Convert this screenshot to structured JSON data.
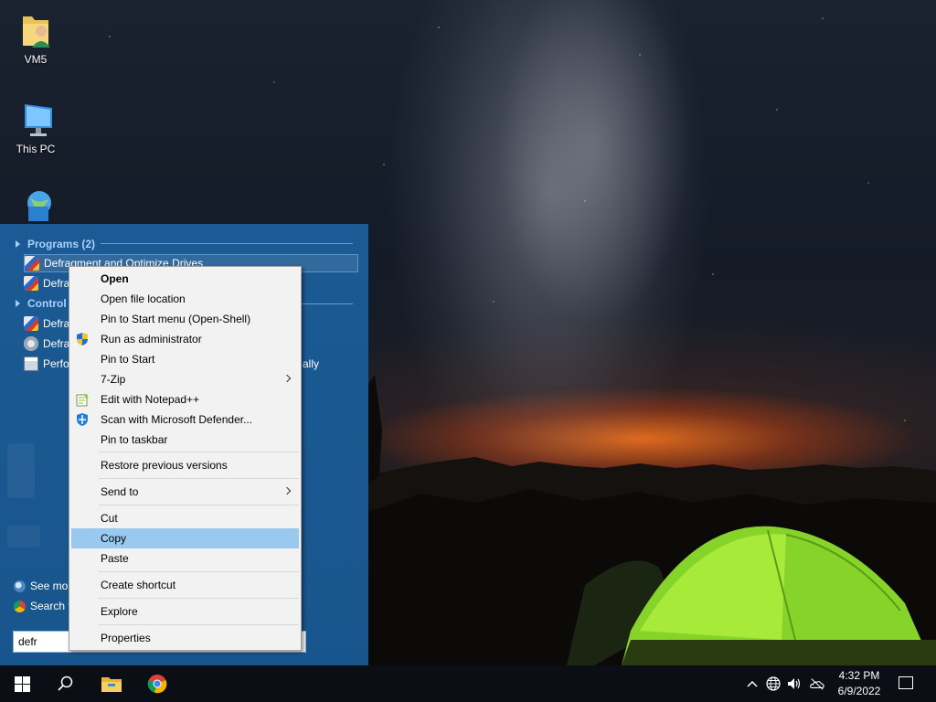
{
  "desktop": {
    "icons": [
      {
        "label": "VM5"
      },
      {
        "label": "This PC"
      },
      {
        "label": ""
      }
    ]
  },
  "start_menu": {
    "programs_header": "Programs (2)",
    "control_header": "Control",
    "program_items": [
      {
        "label": "Defragment and Optimize Drives"
      },
      {
        "label": "Defra"
      }
    ],
    "control_items": [
      {
        "label": "Defra"
      },
      {
        "label": "Defra"
      },
      {
        "label": "Perfo"
      }
    ],
    "trailing_text": "ally",
    "see_more": "See mor",
    "search_web": "Search t",
    "search_value": "defr"
  },
  "context_menu": {
    "items": [
      {
        "label": "Open",
        "bold": true
      },
      {
        "label": "Open file location"
      },
      {
        "label": "Pin to Start menu (Open-Shell)"
      },
      {
        "label": "Run as administrator",
        "icon": "shield-icon"
      },
      {
        "label": "Pin to Start"
      },
      {
        "label": "7-Zip",
        "submenu": true
      },
      {
        "label": "Edit with Notepad++",
        "icon": "notepad-plus-plus-icon"
      },
      {
        "label": "Scan with Microsoft Defender...",
        "icon": "defender-icon"
      },
      {
        "label": "Pin to taskbar"
      },
      {
        "label": "Restore previous versions"
      },
      {
        "label": "Send to",
        "submenu": true
      },
      {
        "label": "Cut"
      },
      {
        "label": "Copy",
        "highlighted": true
      },
      {
        "label": "Paste"
      },
      {
        "label": "Create shortcut"
      },
      {
        "label": "Explore"
      },
      {
        "label": "Properties"
      }
    ]
  },
  "taskbar": {
    "pinned": [
      "windows-start-icon",
      "search-icon",
      "file-explorer-icon",
      "chrome-icon"
    ],
    "tray": [
      "chevron-up-icon",
      "network-icon",
      "volume-icon",
      "onedrive-icon"
    ],
    "time": "4:32 PM",
    "date": "6/9/2022"
  },
  "colors": {
    "start_menu_bg": "#1b5a94",
    "menu_highlight": "#99c9ef",
    "header_text": "#a9d3ff"
  }
}
